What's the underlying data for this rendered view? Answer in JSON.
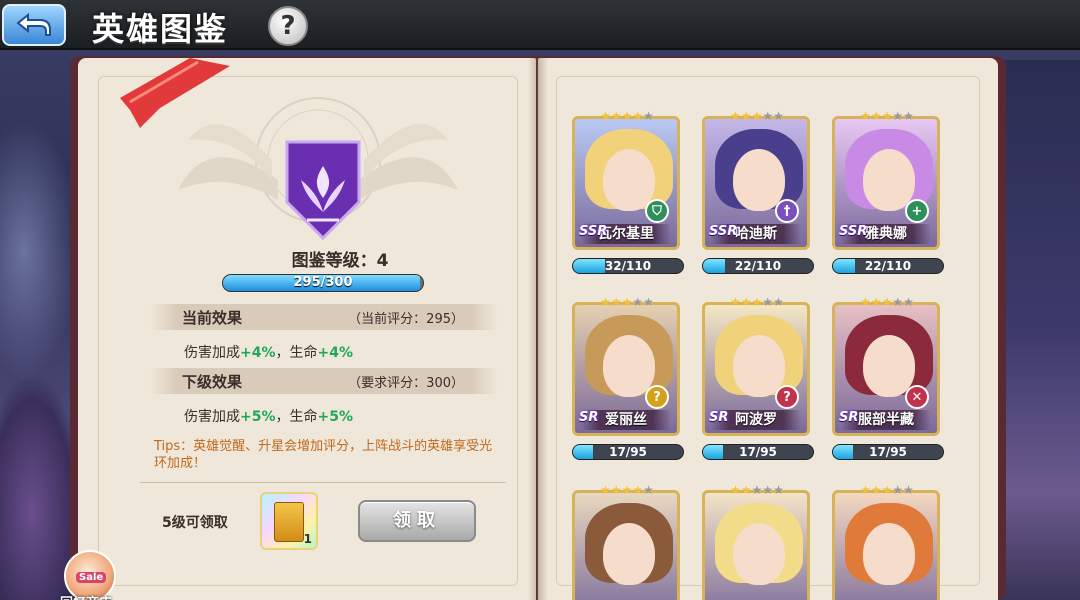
{
  "header": {
    "title": "英雄图鉴",
    "back_icon": "back-arrow-icon",
    "help_label": "?"
  },
  "album": {
    "level_label": "图鉴等级：4",
    "progress_text": "295/300",
    "progress_fraction": 0.983,
    "current_effect": {
      "heading": "当前效果",
      "score": "（当前评分：295）",
      "parts": [
        "伤害加成",
        "+4%",
        "，生命",
        "+4%"
      ]
    },
    "next_effect": {
      "heading": "下级效果",
      "score": "（要求评分：300）",
      "parts": [
        "伤害加成",
        "+5%",
        "，生命",
        "+5%"
      ]
    },
    "tips": "Tips：英雄觉醒、升星会增加评分，上阵战斗的英雄享受光环加成！",
    "claim_label": "5级可领取",
    "reward_qty": "1",
    "claim_button": "领取",
    "shop_label": "回忆商店",
    "shop_tag": "Sale"
  },
  "colors": {
    "accent_green": "#1fa85a",
    "tips_orange": "#c06a1e",
    "progress_blue": "#1c8de0"
  },
  "heroes": [
    {
      "name": "瓦尔基里",
      "rank": "SSR",
      "stars": 4,
      "progress": "32/110",
      "progress_fraction": 0.29,
      "class_icon": "shield-icon",
      "hair": "#f1d27a",
      "bg": "#b9c9f4",
      "cls_color": "#2e8f5a"
    },
    {
      "name": "哈迪斯",
      "rank": "SSR",
      "stars": 3,
      "progress": "22/110",
      "progress_fraction": 0.2,
      "class_icon": "sword-icon",
      "hair": "#4a3f8c",
      "bg": "#c4b8e8",
      "cls_color": "#7a4fbf"
    },
    {
      "name": "雅典娜",
      "rank": "SSR",
      "stars": 3,
      "progress": "22/110",
      "progress_fraction": 0.2,
      "class_icon": "cross-icon",
      "hair": "#c98ae6",
      "bg": "#e8c8f4",
      "cls_color": "#2e8f5a"
    },
    {
      "name": "爱丽丝",
      "rank": "SR",
      "stars": 3,
      "progress": "17/95",
      "progress_fraction": 0.18,
      "class_icon": "question-icon",
      "hair": "#c79a5a",
      "bg": "#e6d0b0",
      "cls_color": "#d4a21a"
    },
    {
      "name": "阿波罗",
      "rank": "SR",
      "stars": 3,
      "progress": "17/95",
      "progress_fraction": 0.18,
      "class_icon": "question-icon",
      "hair": "#f0d27a",
      "bg": "#f4e8c4",
      "cls_color": "#c0334a"
    },
    {
      "name": "服部半藏",
      "rank": "SR",
      "stars": 3,
      "progress": "17/95",
      "progress_fraction": 0.18,
      "class_icon": "crossed-swords-icon",
      "hair": "#8a2a3a",
      "bg": "#e8c0c4",
      "cls_color": "#c0334a"
    },
    {
      "name": "",
      "rank": "",
      "stars": 4,
      "progress": "",
      "progress_fraction": 0,
      "class_icon": "",
      "hair": "#8a5a3a",
      "bg": "#e8d8c0",
      "cls_color": ""
    },
    {
      "name": "",
      "rank": "",
      "stars": 2,
      "progress": "",
      "progress_fraction": 0,
      "class_icon": "",
      "hair": "#f2dc8a",
      "bg": "#f4e4c8",
      "cls_color": ""
    },
    {
      "name": "",
      "rank": "",
      "stars": 3,
      "progress": "",
      "progress_fraction": 0,
      "class_icon": "",
      "hair": "#e07a3a",
      "bg": "#f4d8c0",
      "cls_color": ""
    }
  ]
}
